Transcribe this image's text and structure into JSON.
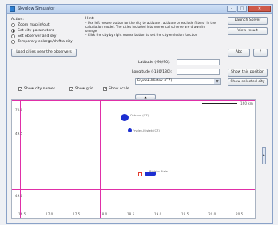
{
  "window": {
    "title": "Skyglow Simulator"
  },
  "action": {
    "heading": "Action:",
    "options": [
      {
        "label": "Zoom map in/out",
        "selected": false
      },
      {
        "label": "Set city parameters",
        "selected": true
      },
      {
        "label": "Set observer and sky",
        "selected": false
      },
      {
        "label": "Temporary enlarge/shift a city",
        "selected": false
      }
    ],
    "load_button": "Load cities near the observers"
  },
  "hint": {
    "heading": "Hint:",
    "lines": [
      "- Use left mouse button for the city to activate , activate or exclude fitters* in the",
      "calculation model. The cities included into numerical scheme are drawn in",
      "orange.",
      "- Click the city by right mouse button to set the city emission function"
    ]
  },
  "coords": {
    "latitude_label": "Latitude (-90/90):",
    "latitude_value": "",
    "longitude_label": "Longitude (-180/180):",
    "longitude_value": "",
    "city_select": "Frydek-Mistek (CZ)"
  },
  "buttons": {
    "launch": "Launch Solver",
    "view_result": "View result",
    "abc": "Abc",
    "help": "?",
    "show_position": "Show this position",
    "show_city": "Show selected city"
  },
  "checkboxes": {
    "city_names": {
      "label": "Show city names",
      "checked": true
    },
    "grid": {
      "label": "Show grid",
      "checked": true
    },
    "scale": {
      "label": "Show scale",
      "checked": true
    }
  },
  "map": {
    "scale_label": "160 km",
    "y_ticks": [
      "70.0",
      "49.5",
      "49.0"
    ],
    "x_ticks": [
      "16.5",
      "17.0",
      "17.5",
      "18.0",
      "18.5",
      "19.0",
      "19.5",
      "20.0",
      "20.5"
    ],
    "cities": [
      "Ostrava (CZ)",
      "Frydek-Mistek (CZ)",
      "Bielsko-Biala"
    ]
  }
}
